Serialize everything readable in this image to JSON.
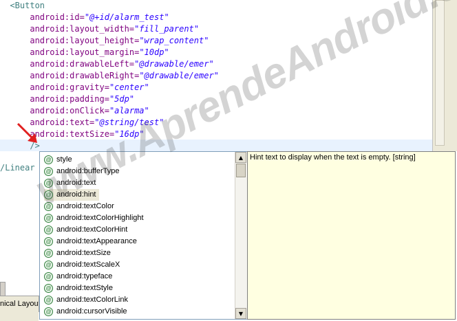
{
  "code_lines": [
    {
      "indent": "  ",
      "tag": "<Button"
    },
    {
      "indent": "      ",
      "attr": "android:id=",
      "val": "\"@+id/alarm_test\""
    },
    {
      "indent": "      ",
      "attr": "android:layout_width=",
      "val": "\"fill_parent\""
    },
    {
      "indent": "      ",
      "attr": "android:layout_height=",
      "val": "\"wrap_content\""
    },
    {
      "indent": "      ",
      "attr": "android:layout_margin=",
      "val": "\"10dp\""
    },
    {
      "indent": "      ",
      "attr": "android:drawableLeft=",
      "val": "\"@drawable/emer\""
    },
    {
      "indent": "      ",
      "attr": "android:drawableRight=",
      "val": "\"@drawable/emer\""
    },
    {
      "indent": "      ",
      "attr": "android:gravity=",
      "val": "\"center\""
    },
    {
      "indent": "      ",
      "attr": "android:padding=",
      "val": "\"5dp\""
    },
    {
      "indent": "      ",
      "attr": "android:onClick=",
      "val": "\"alarma\""
    },
    {
      "indent": "      ",
      "attr": "android:text=",
      "val": "\"@string/test\""
    },
    {
      "indent": "      ",
      "attr": "android:textSize=",
      "val": "\"16dp\""
    },
    {
      "indent": "      ",
      "tag": "/>"
    }
  ],
  "closing_tag": "/Linear",
  "autocomplete": {
    "items": [
      "style",
      "android:bufferType",
      "android:text",
      "android:hint",
      "android:textColor",
      "android:textColorHighlight",
      "android:textColorHint",
      "android:textAppearance",
      "android:textSize",
      "android:textScaleX",
      "android:typeface",
      "android:textStyle",
      "android:textColorLink",
      "android:cursorVisible"
    ],
    "selected_index": 3,
    "item_icon": "at-sign-icon"
  },
  "info_text": "Hint text to display when the text is empty. [string]",
  "bottom_tab_label": "nical Layout",
  "watermark": "www.AprendeAndroid.com",
  "colors": {
    "attr": "#7f007f",
    "value": "#2a00ff",
    "tag": "#3f7f7f",
    "arrow": "#e02020",
    "info_bg": "#ffffe1"
  }
}
